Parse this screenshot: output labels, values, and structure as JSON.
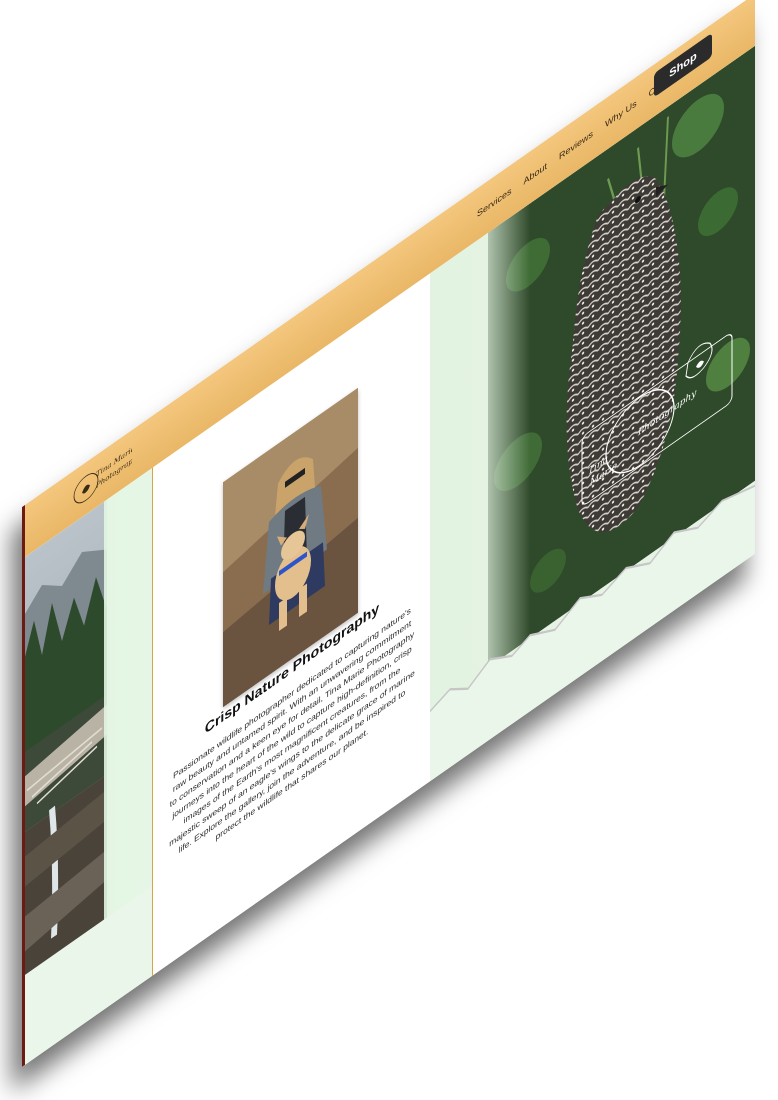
{
  "site": {
    "logo_text": [
      "Tina Marie",
      "Photography"
    ]
  },
  "nav": {
    "items": [
      "Services",
      "About",
      "Reviews",
      "Why Us",
      "Contact"
    ],
    "shop_label": "Shop"
  },
  "about": {
    "title": "Crisp Nature Photography",
    "body": "Passionate wildlife photographer dedicated to capturing nature's raw beauty and untamed spirit. With an unwavering commitment to conservation and a keen eye for detail, Tina Marie Photography journeys into the heart of the wild to capture high-definition, crisp images of the Earth's most magnificent creatures, from the majestic sweep of an eagle's wings to the delicate grace of marine life. Explore the gallery, join the adventure, and be inspired to protect the wildlife that shares our planet."
  },
  "watermark": {
    "text": [
      "Tina",
      "Marie",
      "Photography"
    ]
  },
  "colors": {
    "header": "#f0c272",
    "accent_border": "#d9a544",
    "shop_button": "#2b2b2b",
    "mint": "#e6f3e4"
  },
  "icons": {
    "logo": "camera-bird-logo-icon",
    "watermark": "floral-frame-watermark-icon"
  }
}
